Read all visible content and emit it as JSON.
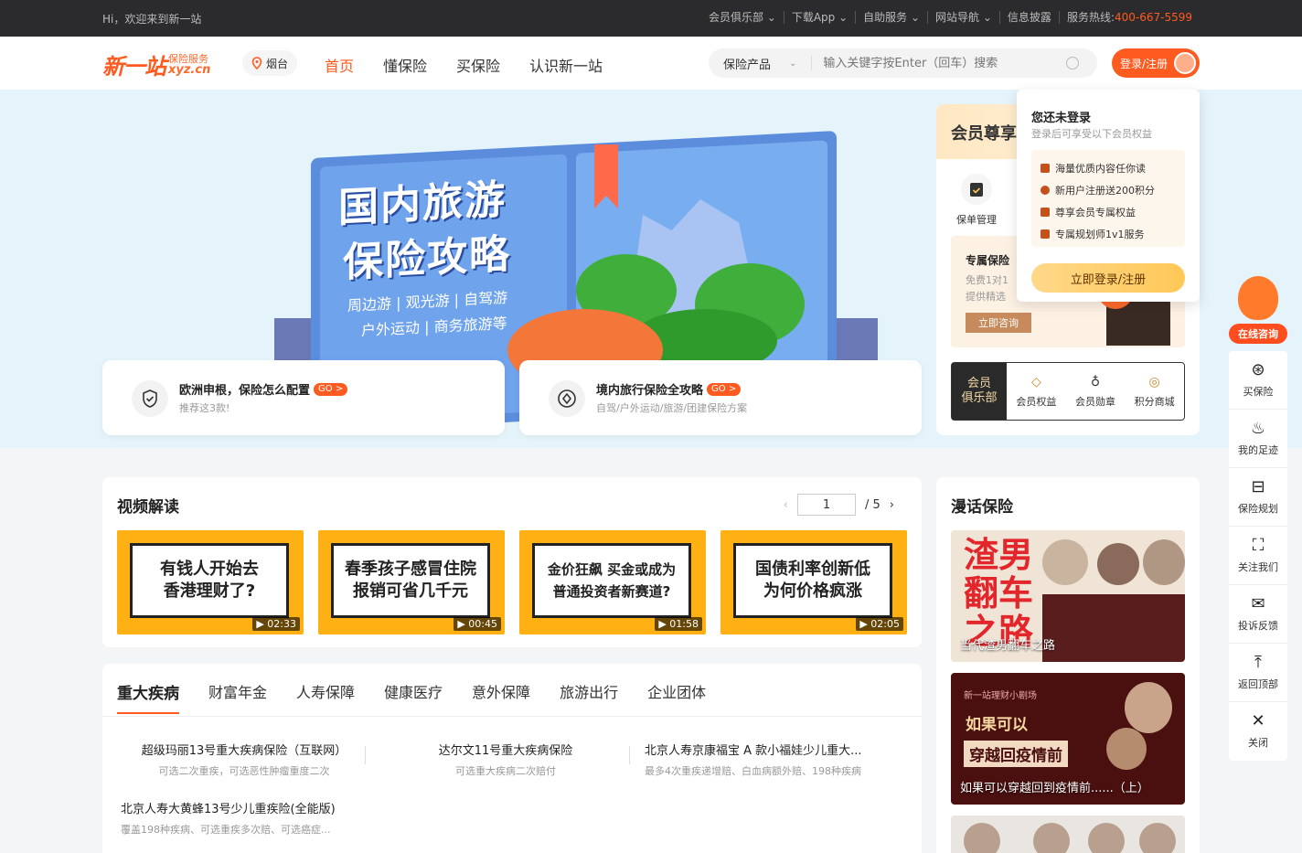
{
  "topbar": {
    "greeting": "Hi，欢迎来到新一站",
    "links": [
      "会员俱乐部 ⌄",
      "下载App ⌄",
      "自助服务 ⌄",
      "网站导航 ⌄",
      "信息披露"
    ],
    "hotline_label": "服务热线:",
    "hotline": "400-667-5599"
  },
  "header": {
    "logo_main": "新一站",
    "logo_sub": "保险服务",
    "logo_domain": "xyz.cn",
    "city": "烟台",
    "nav": [
      "首页",
      "懂保险",
      "买保险",
      "认识新一站"
    ],
    "search_category": "保险产品",
    "search_placeholder": "输入关键字按Enter（回车）搜索",
    "login": "登录/注册"
  },
  "banner": {
    "title1": "国内旅游",
    "title2": "保险攻略",
    "sub1": "周边游 | 观光游 | 自驾游",
    "sub2": "户外运动 | 商务旅游等"
  },
  "cards": [
    {
      "title": "欧洲申根，保险怎么配置",
      "go": "GO >",
      "sub": "推荐这3款!"
    },
    {
      "title": "境内旅行保险全攻略",
      "go": "GO >",
      "sub": "自驾/户外运动/旅游/团建保险方案"
    }
  ],
  "member": {
    "title": "会员尊享",
    "icon_label": "保单管理",
    "plan_title": "专属保险",
    "plan_l1": "免费1对1",
    "plan_l2": "提供精选",
    "consult": "立即咨询",
    "club1": "会员",
    "club2": "俱乐部",
    "club_items": [
      "会员权益",
      "会员勋章",
      "积分商城"
    ]
  },
  "popup": {
    "title": "您还未登录",
    "subtitle": "登录后可享受以下会员权益",
    "benefits": [
      "海量优质内容任你读",
      "新用户注册送200积分",
      "尊享会员专属权益",
      "专属规划师1v1服务"
    ],
    "button": "立即登录/注册"
  },
  "right_sidebar": {
    "consult": "在线咨询",
    "items": [
      "买保险",
      "我的足迹",
      "保险规划",
      "关注我们",
      "投诉反馈",
      "返回顶部",
      "关闭"
    ]
  },
  "video": {
    "title": "视频解读",
    "page": "1",
    "total": "/ 5",
    "items": [
      {
        "t1": "有钱人开始去",
        "t2": "香港理财了?",
        "dur": "▶ 02:33"
      },
      {
        "t1": "春季孩子感冒住院",
        "t2": "报销可省几千元",
        "dur": "▶ 00:45"
      },
      {
        "t1": "金价狂飙 买金或成为",
        "t2": "普通投资者新赛道?",
        "dur": "▶ 01:58"
      },
      {
        "t1": "国债利率创新低",
        "t2": "为何价格疯涨",
        "dur": "▶ 02:05"
      }
    ]
  },
  "comic": {
    "title": "漫话保险",
    "items": [
      {
        "art": "渣男翻车之路",
        "caption": "当代渣男翻车之路"
      },
      {
        "header": "新一站理财小剧场",
        "art1": "如果可以",
        "art2": "穿越回疫情前",
        "caption": "如果可以穿越回到疫情前......（上）"
      }
    ]
  },
  "products": {
    "tabs": [
      "重大疾病",
      "财富年金",
      "人寿保障",
      "健康医疗",
      "意外保障",
      "旅游出行",
      "企业团体"
    ],
    "items": [
      {
        "name": "超级玛丽13号重大疾病保险（互联网）",
        "desc": "可选二次重疾，可选恶性肿瘤重度二次"
      },
      {
        "name": "达尔文11号重大疾病保险",
        "desc": "可选重大疾病二次赔付"
      },
      {
        "name": "北京人寿京康福宝 A 款小福娃少儿重大...",
        "desc": "最多4次重疾递增赔、白血病额外赔、198种疾病"
      },
      {
        "name": "北京人寿大黄蜂13号少儿重疾险(全能版)",
        "desc": "覆盖198种疾病、可选重疾多次赔、可选癌症..."
      }
    ]
  }
}
